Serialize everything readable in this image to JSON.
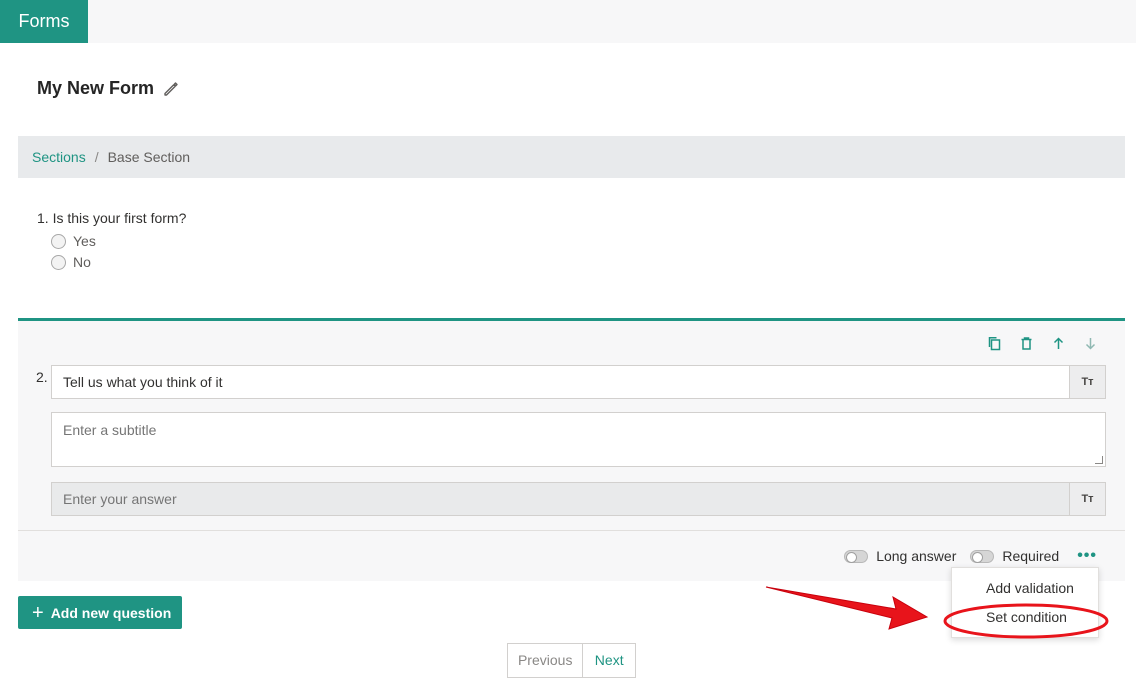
{
  "app": {
    "name": "Forms"
  },
  "form": {
    "title": "My New Form"
  },
  "breadcrumb": {
    "link": "Sections",
    "separator": "/",
    "current": "Base Section"
  },
  "question1": {
    "title": "1. Is this your first form?",
    "options": [
      "Yes",
      "No"
    ]
  },
  "question2": {
    "number": "2.",
    "title_value": "Tell us what you think of it",
    "subtitle_placeholder": "Enter a subtitle",
    "answer_placeholder": "Enter your answer",
    "format_button": "Tт",
    "long_answer_label": "Long answer",
    "required_label": "Required",
    "more_label": "•••"
  },
  "icons": {
    "copy": "copy-icon",
    "delete": "trash-icon",
    "move_up": "arrow-up-icon",
    "move_down": "arrow-down-icon",
    "edit": "pencil-icon",
    "add": "plus-icon"
  },
  "menu": {
    "items": [
      "Add validation",
      "Set condition"
    ]
  },
  "actions": {
    "add_question": "Add new question",
    "plus": "+"
  },
  "pagination": {
    "previous": "Previous",
    "next": "Next"
  },
  "colors": {
    "accent": "#1f9483",
    "annotation": "#e8141b"
  }
}
